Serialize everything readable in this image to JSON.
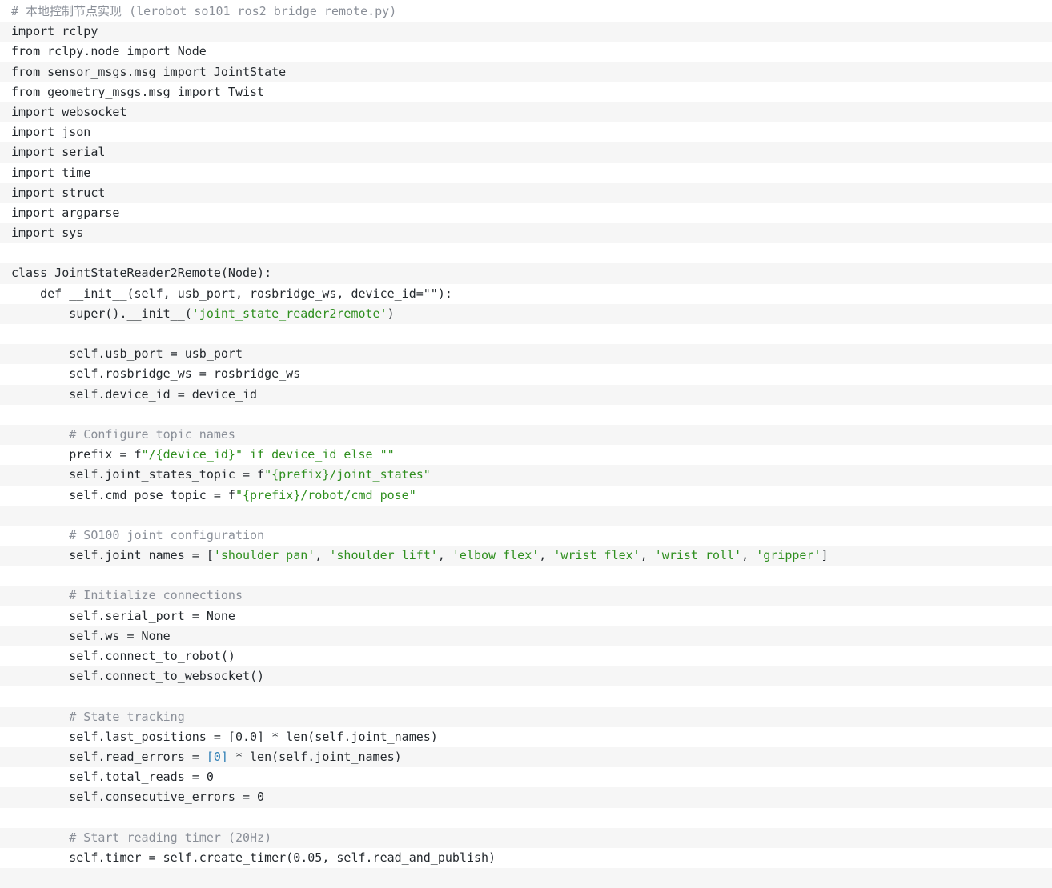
{
  "editor": {
    "lines": [
      [
        {
          "t": "cm",
          "v": "# 本地控制节点实现 (lerobot_so101_ros2_bridge_remote.py)"
        }
      ],
      [
        {
          "t": "plain",
          "v": "import rclpy"
        }
      ],
      [
        {
          "t": "plain",
          "v": "from rclpy.node import Node"
        }
      ],
      [
        {
          "t": "plain",
          "v": "from sensor_msgs.msg import JointState"
        }
      ],
      [
        {
          "t": "plain",
          "v": "from geometry_msgs.msg import Twist"
        }
      ],
      [
        {
          "t": "plain",
          "v": "import websocket"
        }
      ],
      [
        {
          "t": "plain",
          "v": "import json"
        }
      ],
      [
        {
          "t": "plain",
          "v": "import serial"
        }
      ],
      [
        {
          "t": "plain",
          "v": "import time"
        }
      ],
      [
        {
          "t": "plain",
          "v": "import struct"
        }
      ],
      [
        {
          "t": "plain",
          "v": "import argparse"
        }
      ],
      [
        {
          "t": "plain",
          "v": "import sys"
        }
      ],
      [],
      [
        {
          "t": "plain",
          "v": "class JointStateReader2Remote(Node):"
        }
      ],
      [
        {
          "t": "plain",
          "v": "    def __init__(self, usb_port, rosbridge_ws, device_id=\"\"):"
        }
      ],
      [
        {
          "t": "plain",
          "v": "        super().__init__("
        },
        {
          "t": "str",
          "v": "'joint_state_reader2remote'"
        },
        {
          "t": "plain",
          "v": ")"
        }
      ],
      [],
      [
        {
          "t": "plain",
          "v": "        self.usb_port = usb_port"
        }
      ],
      [
        {
          "t": "plain",
          "v": "        self.rosbridge_ws = rosbridge_ws"
        }
      ],
      [
        {
          "t": "plain",
          "v": "        self.device_id = device_id"
        }
      ],
      [],
      [
        {
          "t": "cm",
          "v": "        # Configure topic names"
        }
      ],
      [
        {
          "t": "plain",
          "v": "        prefix = f"
        },
        {
          "t": "str",
          "v": "\"/{device_id}\" if device_id else \"\""
        }
      ],
      [
        {
          "t": "plain",
          "v": "        self.joint_states_topic = f"
        },
        {
          "t": "str",
          "v": "\"{prefix}/joint_states\""
        }
      ],
      [
        {
          "t": "plain",
          "v": "        self.cmd_pose_topic = f"
        },
        {
          "t": "str",
          "v": "\"{prefix}/robot/cmd_pose\""
        }
      ],
      [],
      [
        {
          "t": "cm",
          "v": "        # SO100 joint configuration"
        }
      ],
      [
        {
          "t": "plain",
          "v": "        self.joint_names = ["
        },
        {
          "t": "str",
          "v": "'shoulder_pan'"
        },
        {
          "t": "plain",
          "v": ", "
        },
        {
          "t": "str",
          "v": "'shoulder_lift'"
        },
        {
          "t": "plain",
          "v": ", "
        },
        {
          "t": "str",
          "v": "'elbow_flex'"
        },
        {
          "t": "plain",
          "v": ", "
        },
        {
          "t": "str",
          "v": "'wrist_flex'"
        },
        {
          "t": "plain",
          "v": ", "
        },
        {
          "t": "str",
          "v": "'wrist_roll'"
        },
        {
          "t": "plain",
          "v": ", "
        },
        {
          "t": "str",
          "v": "'gripper'"
        },
        {
          "t": "plain",
          "v": "]"
        }
      ],
      [],
      [
        {
          "t": "cm",
          "v": "        # Initialize connections"
        }
      ],
      [
        {
          "t": "plain",
          "v": "        self.serial_port = None"
        }
      ],
      [
        {
          "t": "plain",
          "v": "        self.ws = None"
        }
      ],
      [
        {
          "t": "plain",
          "v": "        self.connect_to_robot()"
        }
      ],
      [
        {
          "t": "plain",
          "v": "        self.connect_to_websocket()"
        }
      ],
      [],
      [
        {
          "t": "cm",
          "v": "        # State tracking"
        }
      ],
      [
        {
          "t": "plain",
          "v": "        self.last_positions = [0.0] * len(self.joint_names)"
        }
      ],
      [
        {
          "t": "plain",
          "v": "        self.read_errors = "
        },
        {
          "t": "num",
          "v": "[0]"
        },
        {
          "t": "plain",
          "v": " * len(self.joint_names)"
        }
      ],
      [
        {
          "t": "plain",
          "v": "        self.total_reads = 0"
        }
      ],
      [
        {
          "t": "plain",
          "v": "        self.consecutive_errors = 0"
        }
      ],
      [],
      [
        {
          "t": "cm",
          "v": "        # Start reading timer (20Hz)"
        }
      ],
      [
        {
          "t": "plain",
          "v": "        self.timer = self.create_timer(0.05, self.read_and_publish)"
        }
      ],
      []
    ]
  }
}
